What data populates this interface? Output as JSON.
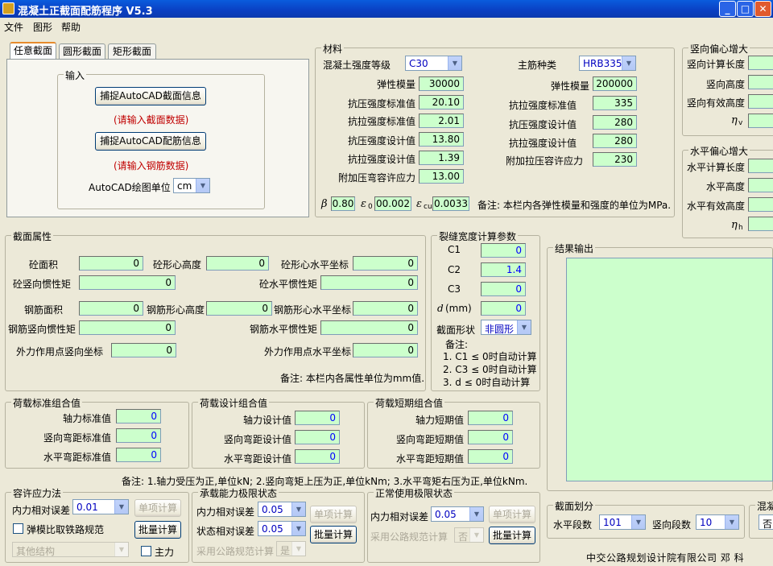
{
  "window": {
    "title": "混凝土正截面配筋程序 V5.3",
    "min": "_",
    "max": "□",
    "close": "✕"
  },
  "menu": [
    "文件",
    "图形",
    "帮助"
  ],
  "tabs": [
    "任意截面",
    "圆形截面",
    "矩形截面"
  ],
  "input_group": {
    "legend": "输入",
    "capture_section": "捕捉AutoCAD截面信息",
    "hint_section": "(请输入截面数据)",
    "capture_rebar": "捕捉AutoCAD配筋信息",
    "hint_rebar": "(请输入钢筋数据)",
    "unit_label": "AutoCAD绘图单位",
    "unit_value": "cm"
  },
  "material": {
    "legend": "材料",
    "concrete_label": "混凝土强度等级",
    "concrete_value": "C30",
    "steel_label": "主筋种类",
    "steel_value": "HRB335",
    "left": [
      {
        "label": "弹性模量",
        "value": "30000"
      },
      {
        "label": "抗压强度标准值",
        "value": "20.10"
      },
      {
        "label": "抗拉强度标准值",
        "value": "2.01"
      },
      {
        "label": "抗压强度设计值",
        "value": "13.80"
      },
      {
        "label": "抗拉强度设计值",
        "value": "1.39"
      },
      {
        "label": "附加压弯容许应力",
        "value": "13.00"
      }
    ],
    "right": [
      {
        "label": "弹性模量",
        "value": "200000"
      },
      {
        "label": "抗拉强度标准值",
        "value": "335"
      },
      {
        "label": "抗压强度设计值",
        "value": "280"
      },
      {
        "label": "抗拉强度设计值",
        "value": "280"
      },
      {
        "label": "附加拉压容许应力",
        "value": "230"
      }
    ],
    "beta_label": "β",
    "beta_value": "0.80",
    "eps0_label": "ε",
    "eps0_sub": "0",
    "eps0_value": "00.002",
    "epscu_label": "ε",
    "epscu_sub": "cu",
    "epscu_value": "0.0033",
    "note": "备注: 本栏内各弹性模量和强度的单位为MPa."
  },
  "vertical_ecc": {
    "legend": "竖向偏心增大",
    "rows": [
      "竖向计算长度",
      "竖向高度",
      "竖向有效高度"
    ],
    "eta": "η",
    "eta_sub": "v"
  },
  "horizontal_ecc": {
    "legend": "水平偏心增大",
    "rows": [
      "水平计算长度",
      "水平高度",
      "水平有效高度"
    ],
    "eta": "η",
    "eta_sub": "h"
  },
  "section_props": {
    "legend": "截面属性",
    "area_label": "砼面积",
    "area_value": "0",
    "centroid_v_label": "砼形心高度",
    "centroid_v_value": "0",
    "centroid_h_label": "砼形心水平坐标",
    "centroid_h_value": "0",
    "inertia_v_label": "砼竖向惯性矩",
    "inertia_v_value": "0",
    "inertia_h_label": "砼水平惯性矩",
    "inertia_h_value": "0",
    "rebar_area_label": "钢筋面积",
    "rebar_area_value": "0",
    "rebar_cent_v_label": "钢筋形心高度",
    "rebar_cent_v_value": "0",
    "rebar_cent_h_label": "钢筋形心水平坐标",
    "rebar_cent_h_value": "0",
    "rebar_inertia_v_label": "钢筋竖向惯性矩",
    "rebar_inertia_v_value": "0",
    "rebar_inertia_h_label": "钢筋水平惯性矩",
    "rebar_inertia_h_value": "0",
    "load_v_label": "外力作用点竖向坐标",
    "load_v_value": "0",
    "load_h_label": "外力作用点水平坐标",
    "load_h_value": "0",
    "note": "备注: 本栏内各属性单位为mm值."
  },
  "crack": {
    "legend": "裂缝宽度计算参数",
    "c1_label": "C1",
    "c1_value": "0",
    "c2_label": "C2",
    "c2_value": "1.4",
    "c3_label": "C3",
    "c3_value": "0",
    "d_label": "d",
    "d_unit": "(mm)",
    "d_value": "0",
    "shape_label": "截面形状",
    "shape_value": "非圆形",
    "note_title": "备注:",
    "notes": [
      "1. C1 ≤ 0时自动计算",
      "2. C3 ≤ 0时自动计算",
      "3.  d  ≤ 0时自动计算"
    ]
  },
  "result": {
    "legend": "结果输出"
  },
  "load_std": {
    "legend": "荷载标准组合值",
    "rows": [
      {
        "label": "轴力标准值",
        "value": "0"
      },
      {
        "label": "竖向弯距标准值",
        "value": "0"
      },
      {
        "label": "水平弯距标准值",
        "value": "0"
      }
    ]
  },
  "load_design": {
    "legend": "荷载设计组合值",
    "rows": [
      {
        "label": "轴力设计值",
        "value": "0"
      },
      {
        "label": "竖向弯距设计值",
        "value": "0"
      },
      {
        "label": "水平弯距设计值",
        "value": "0"
      }
    ]
  },
  "load_short": {
    "legend": "荷载短期组合值",
    "rows": [
      {
        "label": "轴力短期值",
        "value": "0"
      },
      {
        "label": "竖向弯距短期值",
        "value": "0"
      },
      {
        "label": "水平弯距短期值",
        "value": "0"
      }
    ]
  },
  "load_note": "备注: 1.轴力受压为正,单位kN;    2.竖向弯矩上压为正,单位kNm;    3.水平弯矩右压为正,单位kNm.",
  "allow_stress": {
    "legend": "容许应力法",
    "err_label": "内力相对误差",
    "err_value": "0.01",
    "single_btn": "单项计算",
    "railway": "弹模比取铁路规范",
    "batch_btn": "批量计算",
    "struct_value": "其他结构",
    "main_label": "主力"
  },
  "ultimate": {
    "legend": "承载能力极限状态",
    "err_label": "内力相对误差",
    "err_value": "0.05",
    "state_label": "状态相对误差",
    "state_value": "0.05",
    "single_btn": "单项计算",
    "batch_btn": "批量计算",
    "road_label": "采用公路规范计算",
    "road_value": "是"
  },
  "service": {
    "legend": "正常使用极限状态",
    "err_label": "内力相对误差",
    "err_value": "0.05",
    "single_btn": "单项计算",
    "road_label": "采用公路规范计算",
    "road_value": "否",
    "batch_btn": "批量计算"
  },
  "division": {
    "legend": "截面划分",
    "h_label": "水平段数",
    "h_value": "101",
    "v_label": "竖向段数",
    "v_value": "10"
  },
  "concrete_cut": {
    "legend": "混凝",
    "value": "否"
  },
  "footer": "中交公路规划设计院有限公司 邓 科"
}
